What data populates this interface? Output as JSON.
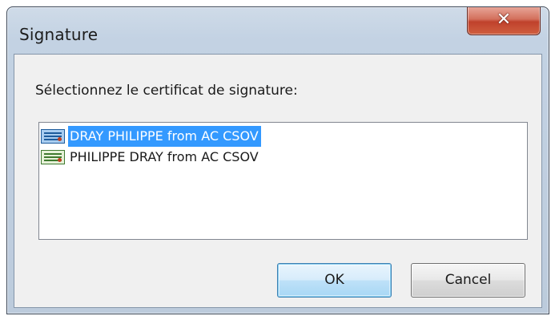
{
  "window": {
    "title": "Signature",
    "close_icon": "✕"
  },
  "dialog": {
    "prompt": "Sélectionnez le certificat de signature:",
    "certificates": [
      {
        "label": "DRAY PHILIPPE from AC CSOV",
        "icon": "certificate-icon",
        "selected": true
      },
      {
        "label": "PHILIPPE DRAY from AC CSOV",
        "icon": "certificate-icon",
        "selected": false
      }
    ]
  },
  "buttons": {
    "ok_label": "OK",
    "cancel_label": "Cancel"
  },
  "colors": {
    "selection_highlight": "#3399ff",
    "close_button": "#c7503a",
    "frame": "#c3d2e3"
  }
}
